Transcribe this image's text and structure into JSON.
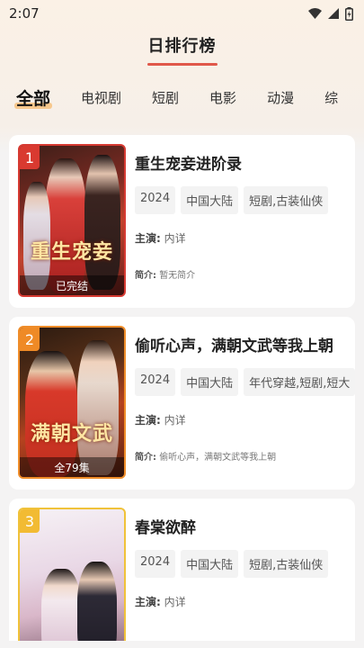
{
  "status": {
    "time": "2:07"
  },
  "header": {
    "title": "日排行榜"
  },
  "tabs": [
    {
      "label": "全部",
      "active": true
    },
    {
      "label": "电视剧",
      "active": false
    },
    {
      "label": "短剧",
      "active": false
    },
    {
      "label": "电影",
      "active": false
    },
    {
      "label": "动漫",
      "active": false
    },
    {
      "label": "综",
      "active": false
    }
  ],
  "items": [
    {
      "rank": "1",
      "title": "重生宠妾进阶录",
      "poster_text": "重生宠妾",
      "badge": "已完结",
      "tags": [
        "2024",
        "中国大陆",
        "短剧,古装仙侠"
      ],
      "cast_label": "主演:",
      "cast": "内详",
      "intro_label": "简介:",
      "intro": "暂无简介"
    },
    {
      "rank": "2",
      "title": "偷听心声，满朝文武等我上朝",
      "poster_text": "满朝文武",
      "badge": "全79集",
      "tags": [
        "2024",
        "中国大陆",
        "年代穿越,短剧,短大"
      ],
      "cast_label": "主演:",
      "cast": "内详",
      "intro_label": "简介:",
      "intro": "偷听心声，满朝文武等我上朝"
    },
    {
      "rank": "3",
      "title": "春棠欲醉",
      "poster_text": "",
      "badge": "",
      "tags": [
        "2024",
        "中国大陆",
        "短剧,古装仙侠"
      ],
      "cast_label": "主演:",
      "cast": "内详",
      "intro_label": "",
      "intro": ""
    }
  ]
}
